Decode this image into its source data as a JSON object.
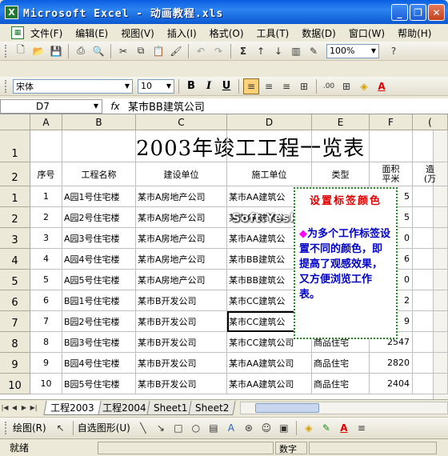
{
  "window": {
    "title": "Microsoft Excel - 动画教程.xls",
    "app_icon": "X"
  },
  "menu": [
    "文件(F)",
    "编辑(E)",
    "视图(V)",
    "插入(I)",
    "格式(O)",
    "工具(T)",
    "数据(D)",
    "窗口(W)",
    "帮助(H)"
  ],
  "toolbar": {
    "zoom": "100%"
  },
  "format": {
    "font": "宋体",
    "size": "10",
    "bold": "B",
    "italic": "I",
    "underline": "U"
  },
  "formula_bar": {
    "name_box": "D7",
    "fx": "fx",
    "formula": "某市BB建筑公司"
  },
  "columns": [
    "A",
    "B",
    "C",
    "D",
    "E",
    "F",
    "("
  ],
  "sheet_title": "2003年竣工工程一览表",
  "headers": {
    "seq": "序号",
    "name": "工程名称",
    "builder": "建设单位",
    "contractor": "施工单位",
    "type": "类型",
    "area1": "面积",
    "area2": "平米",
    "cost1": "造",
    "cost2": "(万"
  },
  "rows": [
    {
      "n": "1",
      "seq": "1",
      "name": "A园1号住宅楼",
      "builder": "某市A房地产公司",
      "contractor": "某市AA建筑公",
      "type": "",
      "area": "5"
    },
    {
      "n": "2",
      "seq": "2",
      "name": "A园2号住宅楼",
      "builder": "某市A房地产公司",
      "contractor": "某市AA建筑公",
      "type": "",
      "area": "5"
    },
    {
      "n": "3",
      "seq": "3",
      "name": "A园3号住宅楼",
      "builder": "某市A房地产公司",
      "contractor": "某市AA建筑公",
      "type": "",
      "area": "0"
    },
    {
      "n": "4",
      "seq": "4",
      "name": "A园4号住宅楼",
      "builder": "某市A房地产公司",
      "contractor": "某市BB建筑公",
      "type": "",
      "area": "6"
    },
    {
      "n": "5",
      "seq": "5",
      "name": "A园5号住宅楼",
      "builder": "某市A房地产公司",
      "contractor": "某市BB建筑公",
      "type": "",
      "area": "0"
    },
    {
      "n": "6",
      "seq": "6",
      "name": "B园1号住宅楼",
      "builder": "某市B开发公司",
      "contractor": "某市CC建筑公",
      "type": "",
      "area": "2"
    },
    {
      "n": "7",
      "seq": "7",
      "name": "B园2号住宅楼",
      "builder": "某市B开发公司",
      "contractor": "某市CC建筑公",
      "type": "",
      "area": "9"
    },
    {
      "n": "8",
      "seq": "8",
      "name": "B园3号住宅楼",
      "builder": "某市B开发公司",
      "contractor": "某市CC建筑公司",
      "type": "商品住宅",
      "area": "2547"
    },
    {
      "n": "9",
      "seq": "9",
      "name": "B园4号住宅楼",
      "builder": "某市B开发公司",
      "contractor": "某市AA建筑公司",
      "type": "商品住宅",
      "area": "2820"
    },
    {
      "n": "10",
      "seq": "10",
      "name": "B园5号住宅楼",
      "builder": "某市B开发公司",
      "contractor": "某市AA建筑公司",
      "type": "商品住宅",
      "area": "2404"
    }
  ],
  "header_rows": [
    "1",
    "2"
  ],
  "note": {
    "title": "设置标签颜色",
    "bullet": "◆",
    "body": "为多个工作标签设置不同的颜色，即提高了观感效果，又方便浏览工作表。"
  },
  "watermark": "Soft.Yesky.c",
  "tabs": [
    "工程2003",
    "工程2004",
    "Sheet1",
    "Sheet2"
  ],
  "drawbar": {
    "draw": "绘图(R)",
    "autoshape": "自选图形(U)"
  },
  "status": {
    "ready": "就绪",
    "num": "数字"
  }
}
